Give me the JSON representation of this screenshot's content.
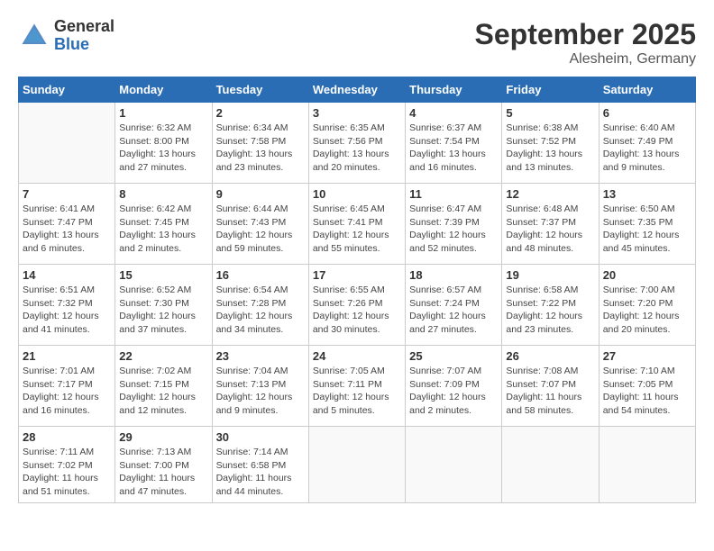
{
  "logo": {
    "general": "General",
    "blue": "Blue"
  },
  "title": {
    "month_year": "September 2025",
    "location": "Alesheim, Germany"
  },
  "weekdays": [
    "Sunday",
    "Monday",
    "Tuesday",
    "Wednesday",
    "Thursday",
    "Friday",
    "Saturday"
  ],
  "weeks": [
    [
      {
        "day": "",
        "info": ""
      },
      {
        "day": "1",
        "info": "Sunrise: 6:32 AM\nSunset: 8:00 PM\nDaylight: 13 hours\nand 27 minutes."
      },
      {
        "day": "2",
        "info": "Sunrise: 6:34 AM\nSunset: 7:58 PM\nDaylight: 13 hours\nand 23 minutes."
      },
      {
        "day": "3",
        "info": "Sunrise: 6:35 AM\nSunset: 7:56 PM\nDaylight: 13 hours\nand 20 minutes."
      },
      {
        "day": "4",
        "info": "Sunrise: 6:37 AM\nSunset: 7:54 PM\nDaylight: 13 hours\nand 16 minutes."
      },
      {
        "day": "5",
        "info": "Sunrise: 6:38 AM\nSunset: 7:52 PM\nDaylight: 13 hours\nand 13 minutes."
      },
      {
        "day": "6",
        "info": "Sunrise: 6:40 AM\nSunset: 7:49 PM\nDaylight: 13 hours\nand 9 minutes."
      }
    ],
    [
      {
        "day": "7",
        "info": "Sunrise: 6:41 AM\nSunset: 7:47 PM\nDaylight: 13 hours\nand 6 minutes."
      },
      {
        "day": "8",
        "info": "Sunrise: 6:42 AM\nSunset: 7:45 PM\nDaylight: 13 hours\nand 2 minutes."
      },
      {
        "day": "9",
        "info": "Sunrise: 6:44 AM\nSunset: 7:43 PM\nDaylight: 12 hours\nand 59 minutes."
      },
      {
        "day": "10",
        "info": "Sunrise: 6:45 AM\nSunset: 7:41 PM\nDaylight: 12 hours\nand 55 minutes."
      },
      {
        "day": "11",
        "info": "Sunrise: 6:47 AM\nSunset: 7:39 PM\nDaylight: 12 hours\nand 52 minutes."
      },
      {
        "day": "12",
        "info": "Sunrise: 6:48 AM\nSunset: 7:37 PM\nDaylight: 12 hours\nand 48 minutes."
      },
      {
        "day": "13",
        "info": "Sunrise: 6:50 AM\nSunset: 7:35 PM\nDaylight: 12 hours\nand 45 minutes."
      }
    ],
    [
      {
        "day": "14",
        "info": "Sunrise: 6:51 AM\nSunset: 7:32 PM\nDaylight: 12 hours\nand 41 minutes."
      },
      {
        "day": "15",
        "info": "Sunrise: 6:52 AM\nSunset: 7:30 PM\nDaylight: 12 hours\nand 37 minutes."
      },
      {
        "day": "16",
        "info": "Sunrise: 6:54 AM\nSunset: 7:28 PM\nDaylight: 12 hours\nand 34 minutes."
      },
      {
        "day": "17",
        "info": "Sunrise: 6:55 AM\nSunset: 7:26 PM\nDaylight: 12 hours\nand 30 minutes."
      },
      {
        "day": "18",
        "info": "Sunrise: 6:57 AM\nSunset: 7:24 PM\nDaylight: 12 hours\nand 27 minutes."
      },
      {
        "day": "19",
        "info": "Sunrise: 6:58 AM\nSunset: 7:22 PM\nDaylight: 12 hours\nand 23 minutes."
      },
      {
        "day": "20",
        "info": "Sunrise: 7:00 AM\nSunset: 7:20 PM\nDaylight: 12 hours\nand 20 minutes."
      }
    ],
    [
      {
        "day": "21",
        "info": "Sunrise: 7:01 AM\nSunset: 7:17 PM\nDaylight: 12 hours\nand 16 minutes."
      },
      {
        "day": "22",
        "info": "Sunrise: 7:02 AM\nSunset: 7:15 PM\nDaylight: 12 hours\nand 12 minutes."
      },
      {
        "day": "23",
        "info": "Sunrise: 7:04 AM\nSunset: 7:13 PM\nDaylight: 12 hours\nand 9 minutes."
      },
      {
        "day": "24",
        "info": "Sunrise: 7:05 AM\nSunset: 7:11 PM\nDaylight: 12 hours\nand 5 minutes."
      },
      {
        "day": "25",
        "info": "Sunrise: 7:07 AM\nSunset: 7:09 PM\nDaylight: 12 hours\nand 2 minutes."
      },
      {
        "day": "26",
        "info": "Sunrise: 7:08 AM\nSunset: 7:07 PM\nDaylight: 11 hours\nand 58 minutes."
      },
      {
        "day": "27",
        "info": "Sunrise: 7:10 AM\nSunset: 7:05 PM\nDaylight: 11 hours\nand 54 minutes."
      }
    ],
    [
      {
        "day": "28",
        "info": "Sunrise: 7:11 AM\nSunset: 7:02 PM\nDaylight: 11 hours\nand 51 minutes."
      },
      {
        "day": "29",
        "info": "Sunrise: 7:13 AM\nSunset: 7:00 PM\nDaylight: 11 hours\nand 47 minutes."
      },
      {
        "day": "30",
        "info": "Sunrise: 7:14 AM\nSunset: 6:58 PM\nDaylight: 11 hours\nand 44 minutes."
      },
      {
        "day": "",
        "info": ""
      },
      {
        "day": "",
        "info": ""
      },
      {
        "day": "",
        "info": ""
      },
      {
        "day": "",
        "info": ""
      }
    ]
  ]
}
